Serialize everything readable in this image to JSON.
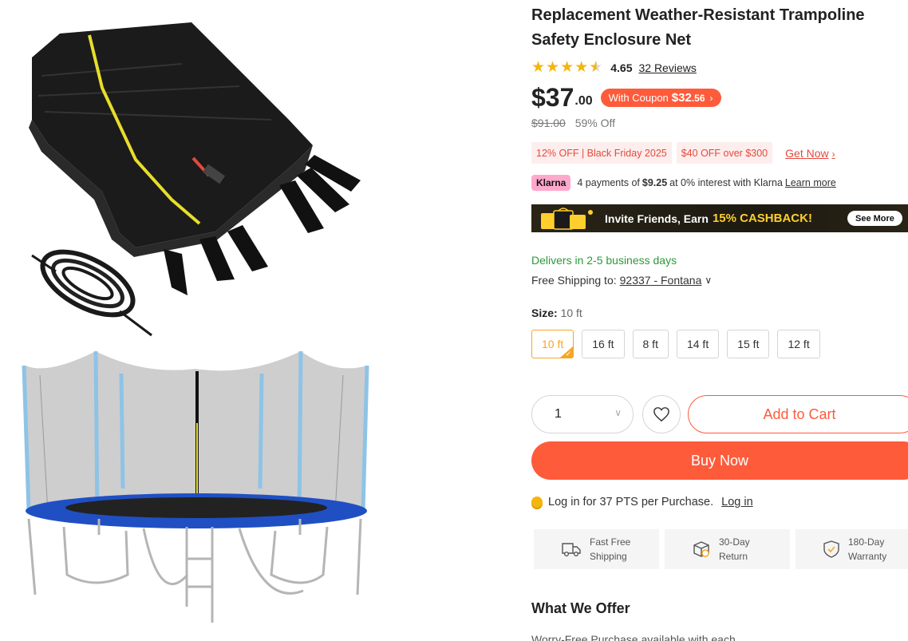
{
  "product": {
    "title": "Replacement Weather-Resistant Trampoline Safety Enclosure Net",
    "rating": "4.65",
    "rating_fraction": 0.93,
    "reviews": "32 Reviews"
  },
  "price": {
    "main": "$37",
    "cents": ".00",
    "coupon_label": "With Coupon",
    "coupon_price": "$32",
    "coupon_cents": ".56",
    "original": "$91.00",
    "discount": "59% Off"
  },
  "promos": {
    "tag1": "12% OFF | Black Friday 2025",
    "tag2": "$40 OFF over $300",
    "get_now": "Get Now"
  },
  "klarna": {
    "badge": "Klarna",
    "text_before": "4 payments of",
    "amount": "$9.25",
    "text_after": "at 0% interest with Klarna",
    "learn_more": "Learn more"
  },
  "banner": {
    "text": "Invite Friends, Earn",
    "highlight": "15% CASHBACK!",
    "button": "See More"
  },
  "shipping": {
    "delivery": "Delivers in 2-5 business days",
    "label": "Free Shipping to:",
    "location": "92337 - Fontana"
  },
  "size": {
    "label": "Size:",
    "selected": "10 ft",
    "options": [
      "10 ft",
      "16 ft",
      "8 ft",
      "14 ft",
      "15 ft",
      "12 ft"
    ]
  },
  "purchase": {
    "quantity": "1",
    "add_to_cart": "Add to Cart",
    "buy_now": "Buy Now"
  },
  "points": {
    "text": "Log in for 37 PTS per Purchase.",
    "link": "Log in"
  },
  "perks": [
    {
      "line1": "Fast Free",
      "line2": "Shipping",
      "icon": "truck-icon"
    },
    {
      "line1": "30-Day",
      "line2": "Return",
      "icon": "return-box-icon"
    },
    {
      "line1": "180-Day",
      "line2": "Warranty",
      "icon": "shield-check-icon"
    }
  ],
  "offer": {
    "heading": "What We Offer",
    "partial": "Worry-Free Purchase available with each"
  },
  "colors": {
    "accent": "#fe5b3b",
    "star": "#f5b50f",
    "green": "#2b9a3a",
    "promo_red": "#e4493d"
  }
}
